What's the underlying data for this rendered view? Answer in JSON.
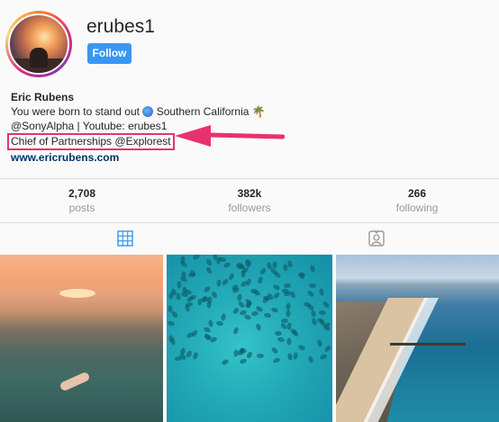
{
  "profile": {
    "username": "erubes1",
    "follow_label": "Follow",
    "full_name": "Eric Rubens",
    "bio_line1_text": "You were born to stand out",
    "bio_line1_location": "Southern California",
    "bio_line2": "@SonyAlpha | Youtube: erubes1",
    "bio_line3": "Chief of Partnerships @Explorest",
    "website": "www.ericrubens.com"
  },
  "stats": [
    {
      "value": "2,708",
      "label": "posts"
    },
    {
      "value": "382k",
      "label": "followers"
    },
    {
      "value": "266",
      "label": "following"
    }
  ],
  "colors": {
    "follow_button": "#3897f0",
    "highlight": "#e6336f",
    "accent_arrow": "#e6336f",
    "link": "#003569"
  },
  "icons": {
    "grid_tab": "grid-icon",
    "tagged_tab": "tagged-portrait-icon",
    "bio_globe": "globe-emoji",
    "bio_palm": "palm-tree-emoji"
  },
  "posts": [
    {
      "description": "sunset-water-floating"
    },
    {
      "description": "aerial-stingrays-turquoise"
    },
    {
      "description": "aerial-beach-pier"
    }
  ]
}
